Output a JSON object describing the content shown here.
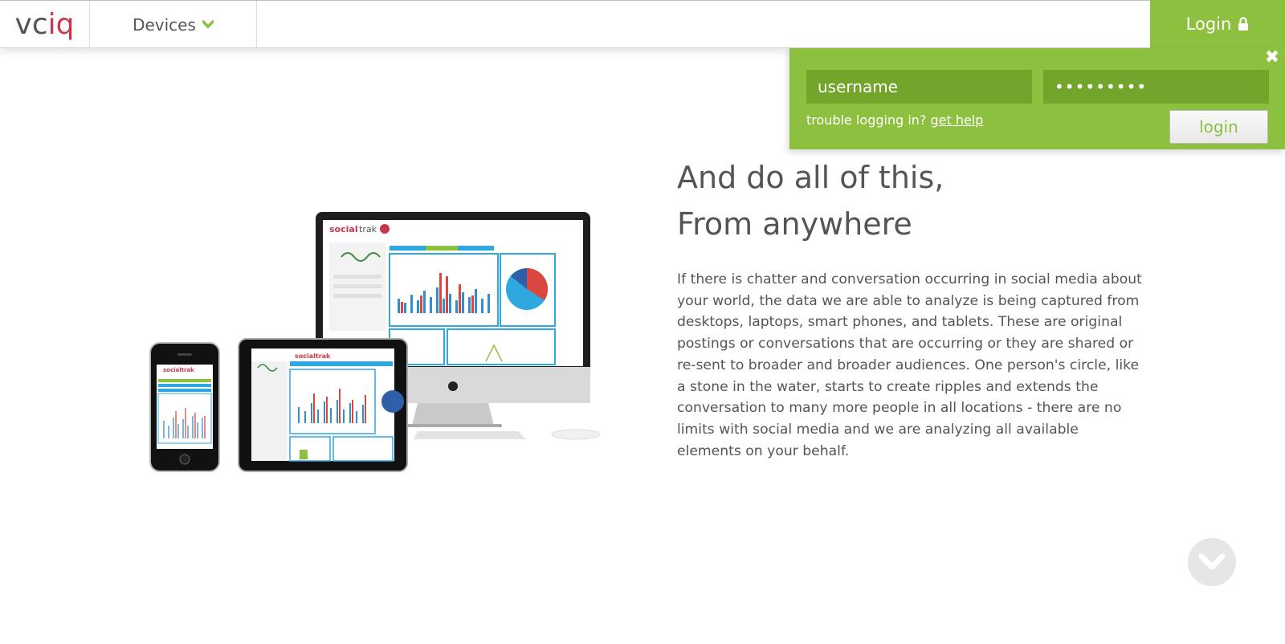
{
  "header": {
    "logo_prefix": "vc",
    "logo_accent": "iq",
    "nav_devices": "Devices",
    "login_tab": "Login"
  },
  "login_panel": {
    "username_value": "username",
    "password_value": "•••••••••",
    "trouble_text": "trouble logging in?",
    "help_link": "get help",
    "login_button": "login",
    "close_glyph": "✖"
  },
  "main": {
    "headline_line1": "And do all of this,",
    "headline_line2": "From anywhere",
    "body": "If there is chatter and conversation occurring in social media about your world, the data we are able to analyze is being captured from desktops, laptops, smart phones, and tablets. These are original postings or conversations that are occurring or they are shared or re-sent to broader and broader audiences. One person's circle, like a stone in the water, starts to create ripples and extends the conversation to many more people in all locations - there are no limits with social media and we are analyzing all available elements on your behalf."
  },
  "illustration": {
    "brand_social": "social",
    "brand_trak": "trak",
    "phone_brand": "socialtrak",
    "ipad_brand": "socialtrak"
  },
  "colors": {
    "accent_green": "#8dc03f",
    "field_green": "#72a52a",
    "logo_red": "#c8374a",
    "text_gray": "#555555"
  },
  "icons": {
    "devices_chevron": "chevron-down-icon",
    "login_lock": "lock-icon",
    "close": "close-icon",
    "scroll": "chevron-down-circle-icon"
  }
}
